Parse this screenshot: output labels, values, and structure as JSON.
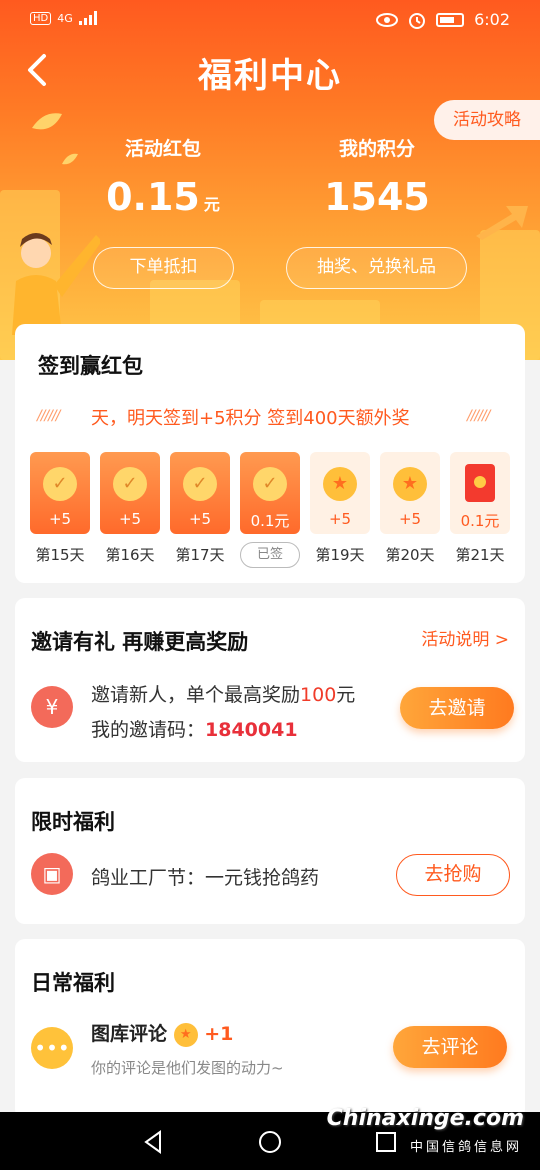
{
  "status_bar": {
    "hd": "HD",
    "network": "4G",
    "time": "6:02"
  },
  "header": {
    "title": "福利中心",
    "guide_label": "活动攻略"
  },
  "stats": {
    "red_packet": {
      "label": "活动红包",
      "value": "0.15",
      "unit": "元",
      "action": "下单抵扣"
    },
    "points": {
      "label": "我的积分",
      "value": "1545",
      "action": "抽奖、兑换礼品"
    }
  },
  "checkin": {
    "title": "签到赢红包",
    "marquee": "天，明天签到+5积分 签到400天额外奖",
    "days": [
      {
        "amount": "+5",
        "label": "第15天",
        "state": "signed",
        "icon": "check-coin-icon"
      },
      {
        "amount": "+5",
        "label": "第16天",
        "state": "signed",
        "icon": "check-coin-icon"
      },
      {
        "amount": "+5",
        "label": "第17天",
        "state": "signed",
        "icon": "check-coin-icon"
      },
      {
        "amount": "0.1元",
        "label": "已签",
        "state": "signed-today",
        "icon": "check-coin-icon"
      },
      {
        "amount": "+5",
        "label": "第19天",
        "state": "future",
        "icon": "star-coin-icon"
      },
      {
        "amount": "+5",
        "label": "第20天",
        "state": "future",
        "icon": "star-coin-icon"
      },
      {
        "amount": "0.1元",
        "label": "第21天",
        "state": "future",
        "icon": "red-packet-icon"
      }
    ]
  },
  "invite": {
    "title": "邀请有礼  再赚更高奖励",
    "link": "活动说明 >",
    "line1_prefix": "邀请新人，单个最高奖励",
    "line1_amount": "100",
    "line1_suffix": "元",
    "line2_prefix": "我的邀请码：",
    "code": "1840041",
    "button": "去邀请"
  },
  "limited": {
    "title": "限时福利",
    "item": "鸽业工厂节：一元钱抢鸽药",
    "button": "去抢购"
  },
  "daily": {
    "title": "日常福利",
    "item_title": "图库评论",
    "reward": "+1",
    "item_desc": "你的评论是他们发图的动力~",
    "button": "去评论"
  },
  "watermark": {
    "main": "Chinaxinge.com",
    "sub": "中国信鸽信息网"
  },
  "colors": {
    "primary": "#ff5a1f",
    "accent": "#ffa63a",
    "highlight_red": "#e8303a"
  }
}
